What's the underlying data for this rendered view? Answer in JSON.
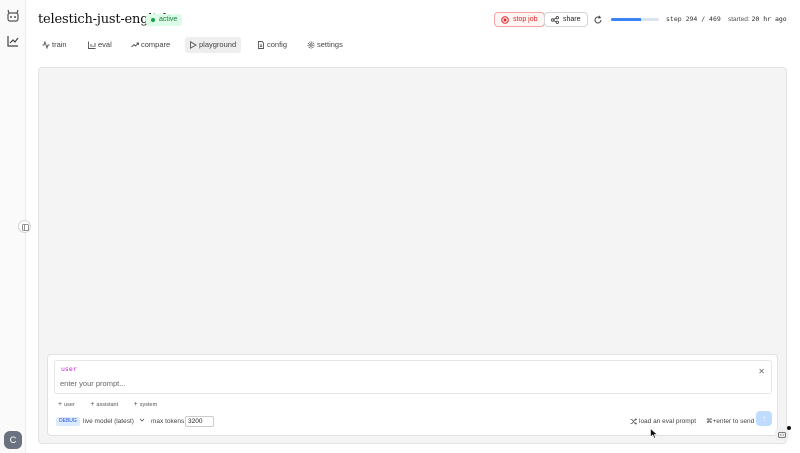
{
  "app": {
    "title": "telestich-just-english",
    "status": "active",
    "avatar_letter": "C"
  },
  "header": {
    "stop_label": "stop job",
    "share_label": "share",
    "progress": {
      "current": 294,
      "total": 469,
      "text": "step 294 / 469"
    },
    "started_label": "started:",
    "started_value": "20 hr ago"
  },
  "tabs": [
    {
      "label": "train",
      "icon": "activity-icon"
    },
    {
      "label": "eval",
      "icon": "bar-chart-icon"
    },
    {
      "label": "compare",
      "icon": "trending-up-icon"
    },
    {
      "label": "playground",
      "icon": "play-icon",
      "active": true
    },
    {
      "label": "config",
      "icon": "file-icon"
    },
    {
      "label": "settings",
      "icon": "gear-icon"
    }
  ],
  "composer": {
    "role": "user",
    "placeholder": "enter your prompt...",
    "add_buttons": [
      "user",
      "assistant",
      "system"
    ],
    "debug_badge": "DEBUG",
    "model": "live model (latest)",
    "max_tokens_label": "max tokens",
    "max_tokens_value": "3200",
    "eval_prompt_label": "load an eval prompt",
    "send_hint": "⌘+enter to send"
  },
  "colors": {
    "accent": "#3b82f6",
    "active_badge": "#16a34a",
    "stop": "#dc2626",
    "role": "#c026d3"
  }
}
